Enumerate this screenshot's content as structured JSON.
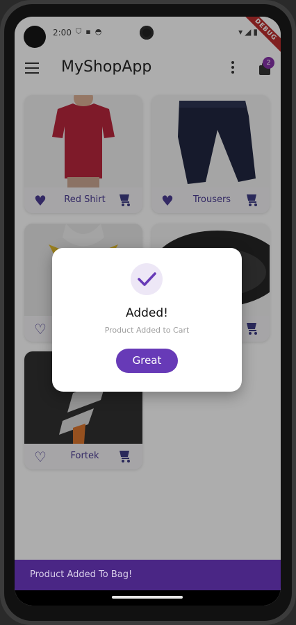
{
  "statusbar": {
    "time": "2:00",
    "debug_label": "DEBUG",
    "icons": [
      "shield-icon",
      "sd-icon",
      "settings-icon"
    ],
    "right_icons": [
      "wifi-icon",
      "signal-icon",
      "battery-icon"
    ]
  },
  "appbar": {
    "title": "MyShopApp",
    "cart_count": "2"
  },
  "products": [
    {
      "name": "Red Shirt",
      "favorite": true
    },
    {
      "name": "Trousers",
      "favorite": true
    },
    {
      "name": "",
      "favorite": false
    },
    {
      "name": "",
      "favorite": false
    },
    {
      "name": "Fortek",
      "favorite": false
    }
  ],
  "dialog": {
    "title": "Added!",
    "message": "Product Added to Cart",
    "button_label": "Great"
  },
  "snackbar": {
    "message": "Product Added To Bag!"
  },
  "colors": {
    "accent": "#673ab7",
    "snackbar": "#4a2685",
    "badge": "#7b1fa2",
    "icon": "#2d2a7a"
  }
}
